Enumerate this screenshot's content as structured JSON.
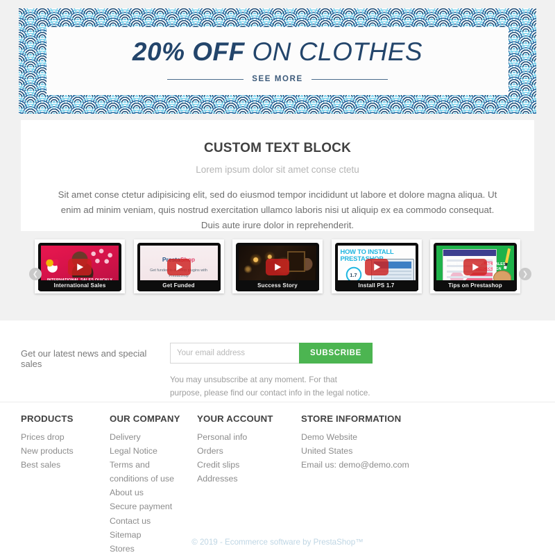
{
  "banner": {
    "title_bold": "20% OFF",
    "title_rest": "ON CLOTHES",
    "see_more_label": "SEE MORE"
  },
  "textblock": {
    "title": "CUSTOM TEXT BLOCK",
    "subtitle": "Lorem ipsum dolor sit amet conse ctetu",
    "body": "Sit amet conse ctetur adipisicing elit, sed do eiusmod tempor incididunt ut labore et dolore magna aliqua. Ut enim ad minim veniam, quis nostrud exercitation ullamco laboris nisi ut aliquip ex ea commodo consequat. Duis aute irure dolor in reprehenderit."
  },
  "carousel": {
    "prev_icon": "chevron-left",
    "next_icon": "chevron-right",
    "items": [
      {
        "label": "International Sales",
        "overlay_text": "INTERNATIONAL SALES QUICKLY"
      },
      {
        "label": "Get Funded",
        "brand_primary": "Presta",
        "brand_accent": "Shop",
        "overlay_text": "Get funded to develop plugins with PrestaShop"
      },
      {
        "label": "Success Story",
        "overlay_text": ""
      },
      {
        "label": "Install PS 1.7",
        "overlay_text": "HOW TO INSTALL PRESTASHOP",
        "badge": "1.7"
      },
      {
        "label": "Tips on Prestashop",
        "overlay_text": "5 TIPS TO BOOST ONLINE SALES THROUGH GRAPHIC DESIGN"
      }
    ]
  },
  "newsletter": {
    "label": "Get our latest news and special sales",
    "email_placeholder": "Your email address",
    "email_value": "",
    "subscribe_label": "SUBSCRIBE",
    "note": "You may unsubscribe at any moment. For that purpose, please find our contact info in the legal notice."
  },
  "footer": {
    "columns": [
      {
        "title": "PRODUCTS",
        "links": [
          "Prices drop",
          "New products",
          "Best sales"
        ]
      },
      {
        "title": "OUR COMPANY",
        "links": [
          "Delivery",
          "Legal Notice",
          "Terms and conditions of use",
          "About us",
          "Secure payment",
          "Contact us",
          "Sitemap",
          "Stores"
        ]
      },
      {
        "title": "YOUR ACCOUNT",
        "links": [
          "Personal info",
          "Orders",
          "Credit slips",
          "Addresses"
        ]
      },
      {
        "title": "STORE INFORMATION",
        "lines": [
          "Demo Website",
          "United States",
          "Email us: demo@demo.com"
        ]
      }
    ],
    "copyright": "© 2019 - Ecommerce software by PrestaShop™"
  },
  "colors": {
    "page_background": "#f1f1f1",
    "banner_navy": "#23456b",
    "banner_wave_dark": "#1f4e79",
    "banner_wave_light": "#7fd3ec",
    "subscribe_green": "#4cb551",
    "heading_dark": "#414141",
    "body_grey": "#7a7a7a",
    "copyright_blue": "#bfd6e4"
  }
}
